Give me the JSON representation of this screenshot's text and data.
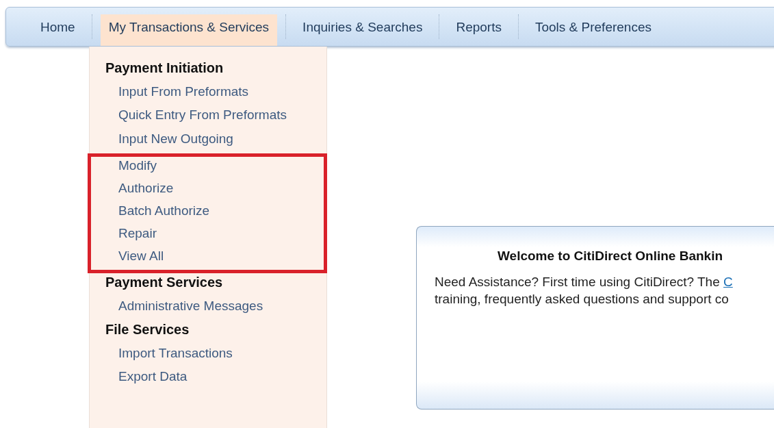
{
  "nav": {
    "tabs": [
      {
        "label": "Home",
        "selected": false
      },
      {
        "label": "My Transactions & Services",
        "selected": true
      },
      {
        "label": "Inquiries & Searches",
        "selected": false
      },
      {
        "label": "Reports",
        "selected": false
      },
      {
        "label": "Tools & Preferences",
        "selected": false
      }
    ]
  },
  "dropdown": {
    "sections": [
      {
        "heading": "Payment Initiation",
        "items": [
          "Input From Preformats",
          "Quick Entry From Preformats",
          "Input New Outgoing"
        ],
        "highlighted_items": [
          "Modify",
          "Authorize",
          "Batch Authorize",
          "Repair",
          "View All"
        ]
      },
      {
        "heading": "Payment Services",
        "items": [
          "Administrative Messages"
        ]
      },
      {
        "heading": "File Services",
        "items": [
          "Import Transactions",
          "Export Data"
        ]
      }
    ]
  },
  "welcome": {
    "title": "Welcome to CitiDirect Online Bankin",
    "text_before_link": "Need Assistance? First time using CitiDirect? The ",
    "link": "C",
    "text_line_2": "training, frequently asked questions and support co"
  }
}
